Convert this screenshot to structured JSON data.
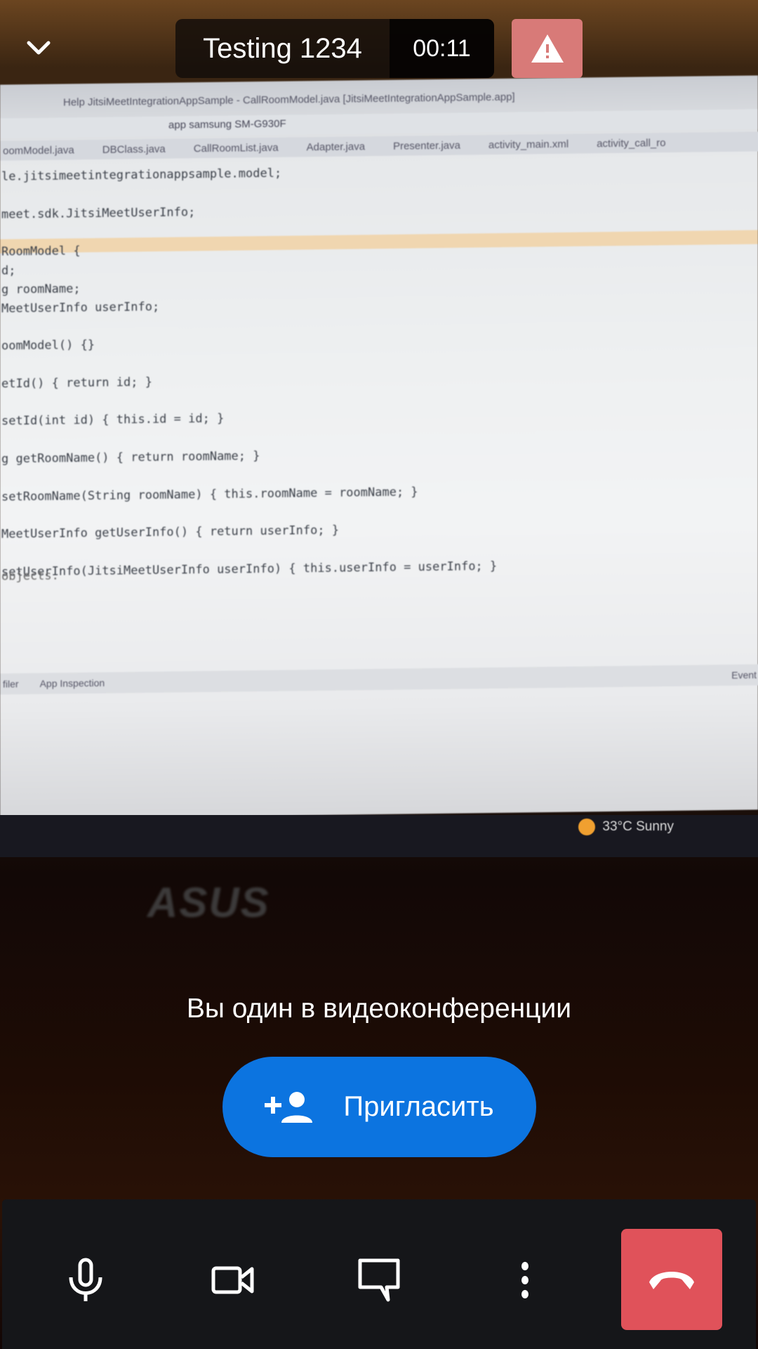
{
  "header": {
    "conference_title": "Testing 1234",
    "timer": "00:11",
    "colors": {
      "warning": "#d87a78"
    }
  },
  "camera_feed": {
    "ide_title": "Help     JitsiMeetIntegrationAppSample - CallRoomModel.java [JitsiMeetIntegrationAppSample.app]",
    "ide_toolbar": "app   samsung SM-G930F",
    "ide_tabs": [
      "oomModel.java",
      "DBClass.java",
      "CallRoomList.java",
      "Adapter.java",
      "Presenter.java",
      "activity_main.xml",
      "activity_call_ro"
    ],
    "code_lines": [
      "le.jitsimeetintegrationappsample.model;",
      "",
      "meet.sdk.JitsiMeetUserInfo;",
      "",
      "RoomModel {",
      "d;",
      "g roomName;",
      "MeetUserInfo userInfo;",
      "",
      "oomModel() {}",
      "",
      "etId() { return id; }",
      "",
      "setId(int id) { this.id = id; }",
      "",
      "g getRoomName() { return roomName; }",
      "",
      "setRoomName(String roomName) { this.roomName = roomName; }",
      "",
      "MeetUserInfo getUserInfo() { return userInfo; }",
      "",
      "setUserInfo(JitsiMeetUserInfo userInfo) { this.userInfo = userInfo; }"
    ],
    "ide_footer": "objects.",
    "ide_status": [
      "filer",
      "App Inspection",
      "Event"
    ],
    "weather": "33°C  Sunny",
    "laptop_brand": "ASUS"
  },
  "main": {
    "alone_message": "Вы один в видеоконференции",
    "invite_label": "Пригласить",
    "colors": {
      "invite": "#0c74e0"
    }
  },
  "toolbar": {
    "buttons": [
      "microphone",
      "camera",
      "chat",
      "more",
      "hangup"
    ],
    "colors": {
      "hangup": "#e0525a",
      "background": "#151619"
    }
  }
}
